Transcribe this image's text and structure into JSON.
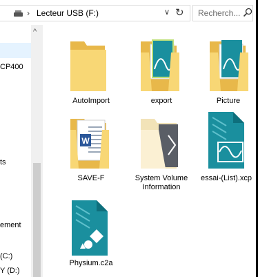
{
  "address_bar": {
    "path": "Lecteur USB (F:)",
    "separator": "›",
    "dropdown_glyph": "∨",
    "refresh_glyph": "↻"
  },
  "search": {
    "placeholder": "Recherch..."
  },
  "navigation": {
    "scroll_up_glyph": "^",
    "items": [
      "CP400",
      "ts",
      "ement",
      "(C:)",
      "Y (D:)"
    ]
  },
  "files": [
    {
      "name": "AutoImport",
      "type": "folder"
    },
    {
      "name": "export",
      "type": "folder-with-document"
    },
    {
      "name": "Picture",
      "type": "folder-with-document"
    },
    {
      "name": "SAVE-F",
      "type": "folder-with-word-document"
    },
    {
      "name": "System Volume Information",
      "type": "hidden-system-folder"
    },
    {
      "name": "essai-(List).xcp",
      "type": "xcp-file"
    },
    {
      "name": "Physium.c2a",
      "type": "c2a-file"
    }
  ],
  "colors": {
    "folder_body": "#F8D775",
    "folder_back": "#E8B84A",
    "teal": "#1A8F9E",
    "teal_dark": "#0E6F7C",
    "selection": "#E5F3FF",
    "word_blue": "#2B579A"
  }
}
